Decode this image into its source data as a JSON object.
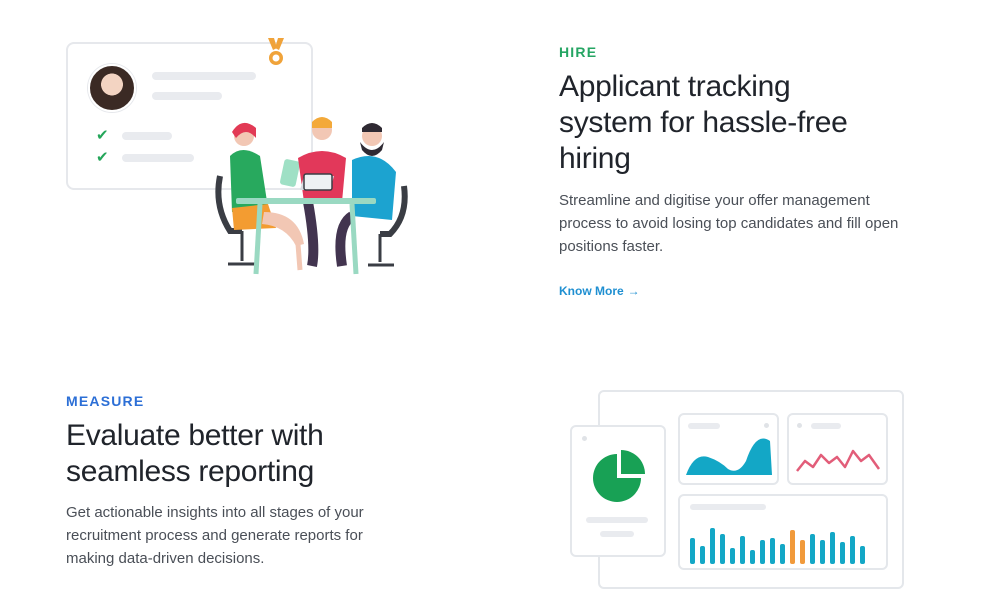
{
  "hire": {
    "eyebrow": "HIRE",
    "title": "Applicant tracking system for hassle-free hiring",
    "description": "Streamline and digitise your offer management process to avoid losing top candidates and fill open positions faster.",
    "link_label": "Know More",
    "link_icon": "arrow-right-icon",
    "accent": "#25a563"
  },
  "measure": {
    "eyebrow": "MEASURE",
    "title": "Evaluate better with seamless reporting",
    "description": "Get actionable insights into all stages of your recruitment process and generate reports for making data-driven decisions.",
    "accent": "#2c6fd6"
  },
  "colors": {
    "link": "#1f8fd1",
    "chart_teal": "#13a7c6",
    "chart_orange": "#f19a3b",
    "chart_pink": "#e25d79",
    "pie_green": "#18a155"
  }
}
